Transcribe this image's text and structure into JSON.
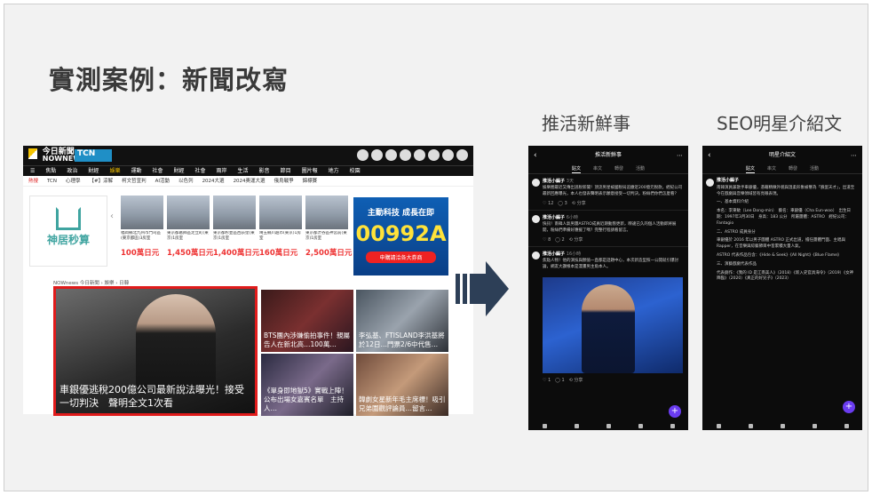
{
  "slide": {
    "title": "實測案例：新聞改寫",
    "caption_left": "推活新鮮事",
    "caption_right": "SEO明星介紹文"
  },
  "news_site": {
    "logo_zh": "今日新聞",
    "logo_en": "NOWNEWS",
    "partner": "TCN",
    "nav": [
      "☰",
      "焦點",
      "政治",
      "財經",
      "娛樂",
      "運動",
      "社會",
      "財經",
      "社會",
      "兩岸",
      "生活",
      "影音",
      "節目",
      "圖片報",
      "地方",
      "校園"
    ],
    "tags": [
      "熱搜",
      "TCN",
      "心理學",
      "【#】涼解",
      "柯文哲宣判",
      "AI活動",
      "以色列",
      "2024大選",
      "2024奧運大選",
      "俄烏戰爭",
      "錦標賽"
    ],
    "ad_brand": "神居秒算",
    "properties": [
      {
        "desc": "福岡縣北九州市門司區(東京都區)3房室",
        "price": "100萬日元"
      },
      {
        "desc": "東京都葛飾區足立町(東京)1房室",
        "price": "1,450萬日元"
      },
      {
        "desc": "東京都杉並區西荻窪(東京)1房室",
        "price": "1,400萬日元"
      },
      {
        "desc": "埼玉縣川越市(東京)1房室",
        "price": "160萬日元"
      },
      {
        "desc": "東京都渋谷區神宮前(東京)1房室",
        "price": "2,500萬日元"
      }
    ],
    "fund_ad": {
      "line1": "主動科技 成長在即",
      "code": "00992A",
      "cta": "申購請洽各大券商"
    },
    "breadcrumb": "NOWnews 今日新聞 › 娛樂 › 日韓",
    "headline": "車銀優逃稅200億公司最新說法曝光！接受一切判決　聲明全文1次看",
    "tiles": [
      "BTS團內涉嫌偷拍事件！親屬告人在新北高…100萬…",
      "李弘基、FTISLAND李洪基將於12日…門票2/6中代售…",
      "《單身即地獄5》實戰上陣！公布出場女嘉賓名單　主持人…",
      "韓劇女星新年毛主席標！吸引兄弟圍觀評論員…留言…"
    ]
  },
  "phone_left": {
    "header": "推活新鮮事",
    "tabs": [
      "貼文",
      "串文",
      "轉發",
      "活動"
    ],
    "posts": [
      {
        "author": "推活小編子",
        "time": "3天",
        "body": "娛樂圈最近又傳出逃稅新聞！頂流男星被國稅局追繳近200億元稅款，經紀公司最新回應曝光，本人也發表聲明表示願意接受一切判決。粉絲們你們怎麼看？",
        "acts": "♡ 12　◯ 3　⟲ 分享"
      },
      {
        "author": "推活小編子",
        "time": "6小時",
        "body": "快訊！南韓人氣男團ASTRO成員近期動態更新，睽違已久的個人活動即將展開，粉絲們準備好應援了嗎？完整行程請看留言。",
        "acts": "♡ 8　◯ 2　⟲ 分享"
      },
      {
        "author": "推活小編子",
        "time": "16小時",
        "body": "焦點人物！他的演技與顏值一直都是話題中心，本次新造型照一公開就引爆討論，網友大讚根本是漫畫男主角本人。",
        "acts": "♡ 1　◯ 1　⟲ 分享"
      }
    ]
  },
  "phone_right": {
    "header": "明星介紹文",
    "tabs": [
      "貼文",
      "串文",
      "轉發",
      "活動"
    ],
    "author": "推活小編子",
    "paragraphs": [
      "南韓演員兼歌手車銀優，憑藉精緻外貌與溫柔形象被譽為「臉蛋天才」，出道至今在戲劇與音樂領域皆有亮眼表現。",
      "一、基本資料介紹",
      "本名：李東敏（Lee Dong-min）　藝名：車銀優（Cha Eun-woo）　出生日期：1997年3月30日　身高：183 公分　所屬團體：ASTRO　經紀公司：Fantagio",
      "二、ASTRO 成員身分",
      "車銀優於 2016 年以男子團體 ASTRO 正式出道，擔任團體門面、主唱與 Rapper，在音樂與綜藝節目中皆累積大量人氣。",
      "ASTRO 代表作品包含：《Hide & Seek》《All Night》《Blue Flame》",
      "三、演藝戲劇代表作品",
      "代表劇作：《我的 ID 是江南美人》（2018）《新入史官具海令》（2019）《女神降臨》（2020）《真正的好兒子》（2023）"
    ]
  },
  "colors": {
    "highlight_box": "#e01b1b",
    "arrow": "#2d3f57",
    "fab": "#6a3cf0"
  }
}
